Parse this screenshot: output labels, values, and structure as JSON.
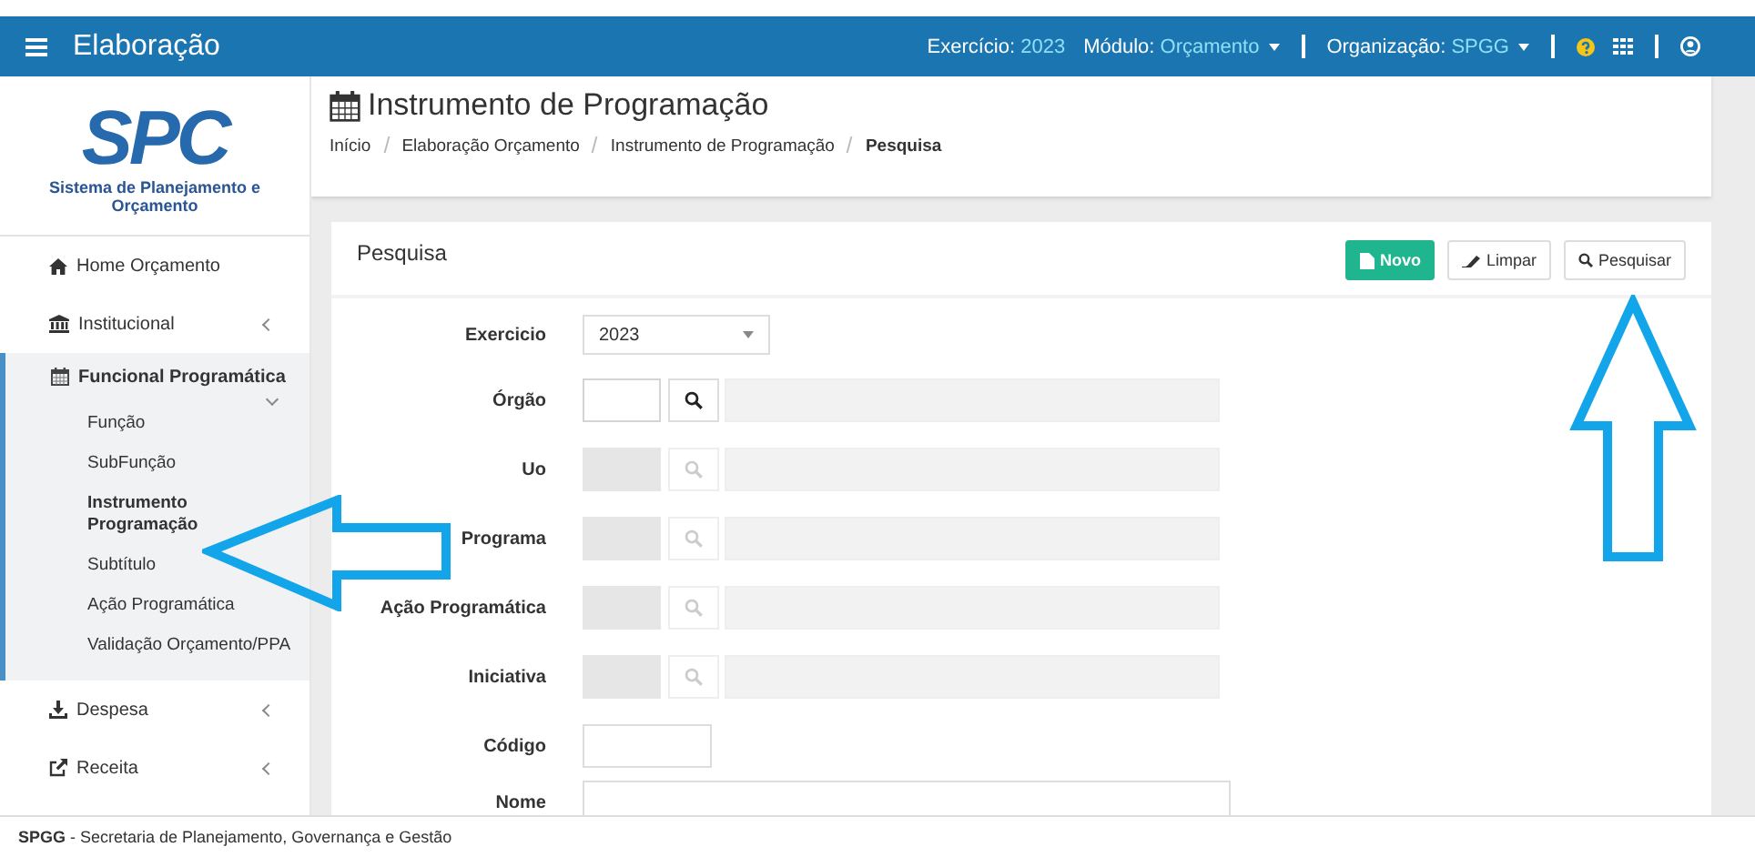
{
  "topbar": {
    "title": "Elaboração",
    "context": [
      {
        "label": "Exercício:",
        "value": "2023",
        "dropdown": false
      },
      {
        "label": "Módulo:",
        "value": "Orçamento",
        "dropdown": true
      },
      {
        "label": "Organização:",
        "value": "SPGG",
        "dropdown": true
      }
    ]
  },
  "logo": {
    "mark": "SPC",
    "subtitle": "Sistema de Planejamento e Orçamento"
  },
  "sidebar": {
    "items": [
      {
        "label": "Home Orçamento"
      },
      {
        "label": "Institucional",
        "expanded": false
      },
      {
        "label": "Funcional Programática",
        "expanded": true,
        "children": [
          {
            "label": "Função",
            "selected": false
          },
          {
            "label": "SubFunção",
            "selected": false
          },
          {
            "label": "Instrumento Programação",
            "selected": true
          },
          {
            "label": "Subtítulo",
            "selected": false
          },
          {
            "label": "Ação Programática",
            "selected": false
          },
          {
            "label": "Validação Orçamento/PPA",
            "selected": false
          }
        ]
      },
      {
        "label": "Despesa",
        "expanded": false
      },
      {
        "label": "Receita",
        "expanded": false
      }
    ]
  },
  "page": {
    "title": "Instrumento de Programação",
    "breadcrumb": [
      "Início",
      "Elaboração Orçamento",
      "Instrumento de Programação",
      "Pesquisa"
    ]
  },
  "panel": {
    "title": "Pesquisa",
    "buttons": [
      {
        "label": "Novo",
        "kind": "primary"
      },
      {
        "label": "Limpar",
        "kind": "default"
      },
      {
        "label": "Pesquisar",
        "kind": "default"
      }
    ],
    "fields": [
      {
        "label": "Exercicio",
        "kind": "select",
        "value": "2023"
      },
      {
        "label": "Órgão",
        "kind": "lookup",
        "disabled": false
      },
      {
        "label": "Uo",
        "kind": "lookup",
        "disabled": true
      },
      {
        "label": "Programa",
        "kind": "lookup",
        "disabled": true
      },
      {
        "label": "Ação Programática",
        "kind": "lookup",
        "disabled": true
      },
      {
        "label": "Iniciativa",
        "kind": "lookup",
        "disabled": true
      },
      {
        "label": "Código",
        "kind": "short"
      },
      {
        "label": "Nome",
        "kind": "wide"
      }
    ]
  },
  "footer": {
    "org": "SPGG",
    "text": " - Secretaria de Planejamento, Governança e Gestão"
  }
}
